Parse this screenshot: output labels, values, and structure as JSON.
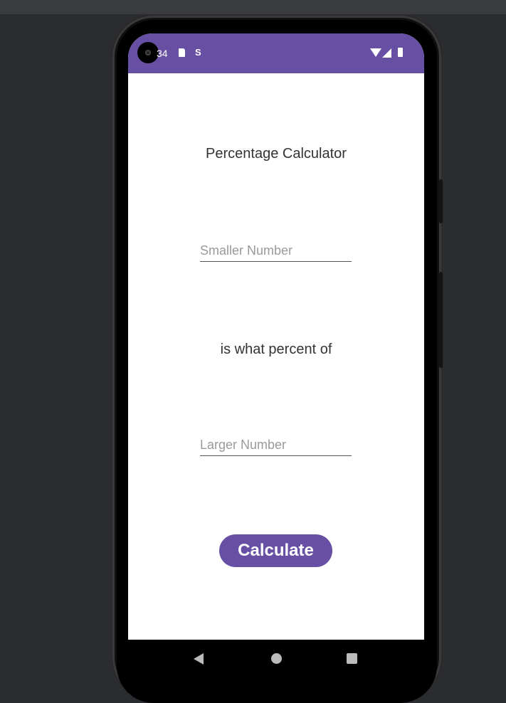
{
  "status_bar": {
    "time": "34",
    "icons": [
      "sd-card-icon",
      "s-notification-icon",
      "wifi-icon",
      "signal-icon",
      "battery-icon"
    ]
  },
  "app": {
    "title": "Percentage Calculator",
    "smaller_placeholder": "Smaller Number",
    "smaller_value": "",
    "middle_text": "is what percent of",
    "larger_placeholder": "Larger Number",
    "larger_value": "",
    "button_label": "Calculate"
  },
  "nav": {
    "back": "back-icon",
    "home": "home-icon",
    "recents": "recents-icon"
  },
  "colors": {
    "accent": "#6750a4",
    "background": "#ffffff",
    "desktop": "#2b2c2f"
  }
}
